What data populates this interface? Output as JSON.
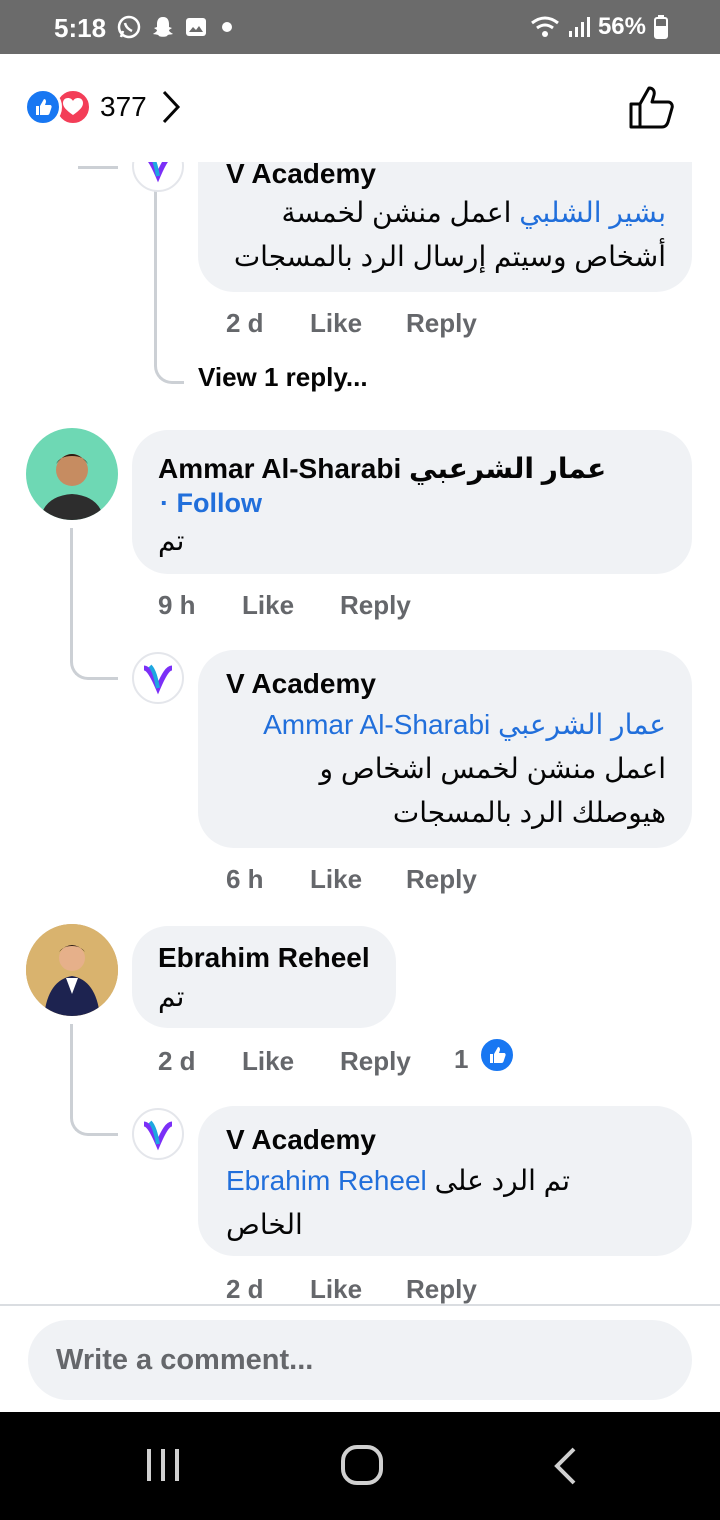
{
  "status_bar": {
    "time": "5:18",
    "battery": "56%"
  },
  "header": {
    "reaction_count": "377"
  },
  "comments": [
    {
      "id": "reply-vacademy-1",
      "author": "V Academy",
      "mention": "بشير الشلبي",
      "line1": "اعمل منشن لخمسة",
      "line2": "أشخاص وسيتم إرسال الرد بالمسجات",
      "time": "2 d",
      "like": "Like",
      "reply": "Reply",
      "view_replies": "View 1 reply..."
    },
    {
      "id": "comment-ammar",
      "author": "Ammar Al-Sharabi",
      "author_ar": "عمار الشرعبي",
      "follow": "· Follow",
      "text": "تم",
      "time": "9 h",
      "like": "Like",
      "reply": "Reply"
    },
    {
      "id": "reply-vacademy-2",
      "author": "V Academy",
      "mention_en": "Ammar Al-Sharabi",
      "mention_ar": "عمار الشرعبي",
      "line1": "اعمل منشن لخمس اشخاص و",
      "line2": "هيوصلك الرد بالمسجات",
      "time": "6 h",
      "like": "Like",
      "reply": "Reply"
    },
    {
      "id": "comment-ebrahim",
      "author": "Ebrahim Reheel",
      "text": "تم",
      "time": "2 d",
      "like": "Like",
      "reply": "Reply",
      "like_count": "1"
    },
    {
      "id": "reply-vacademy-3",
      "author": "V Academy",
      "mention": "Ebrahim Reheel",
      "line1_after": "تم الرد على",
      "line2": "الخاص",
      "time": "2 d",
      "like": "Like",
      "reply": "Reply"
    }
  ],
  "composer": {
    "placeholder": "Write a comment..."
  },
  "colors": {
    "link": "#216fdb",
    "bubble": "#f0f2f5",
    "meta": "#65676b",
    "like_blue": "#1877f2",
    "love_red": "#f33e58"
  }
}
